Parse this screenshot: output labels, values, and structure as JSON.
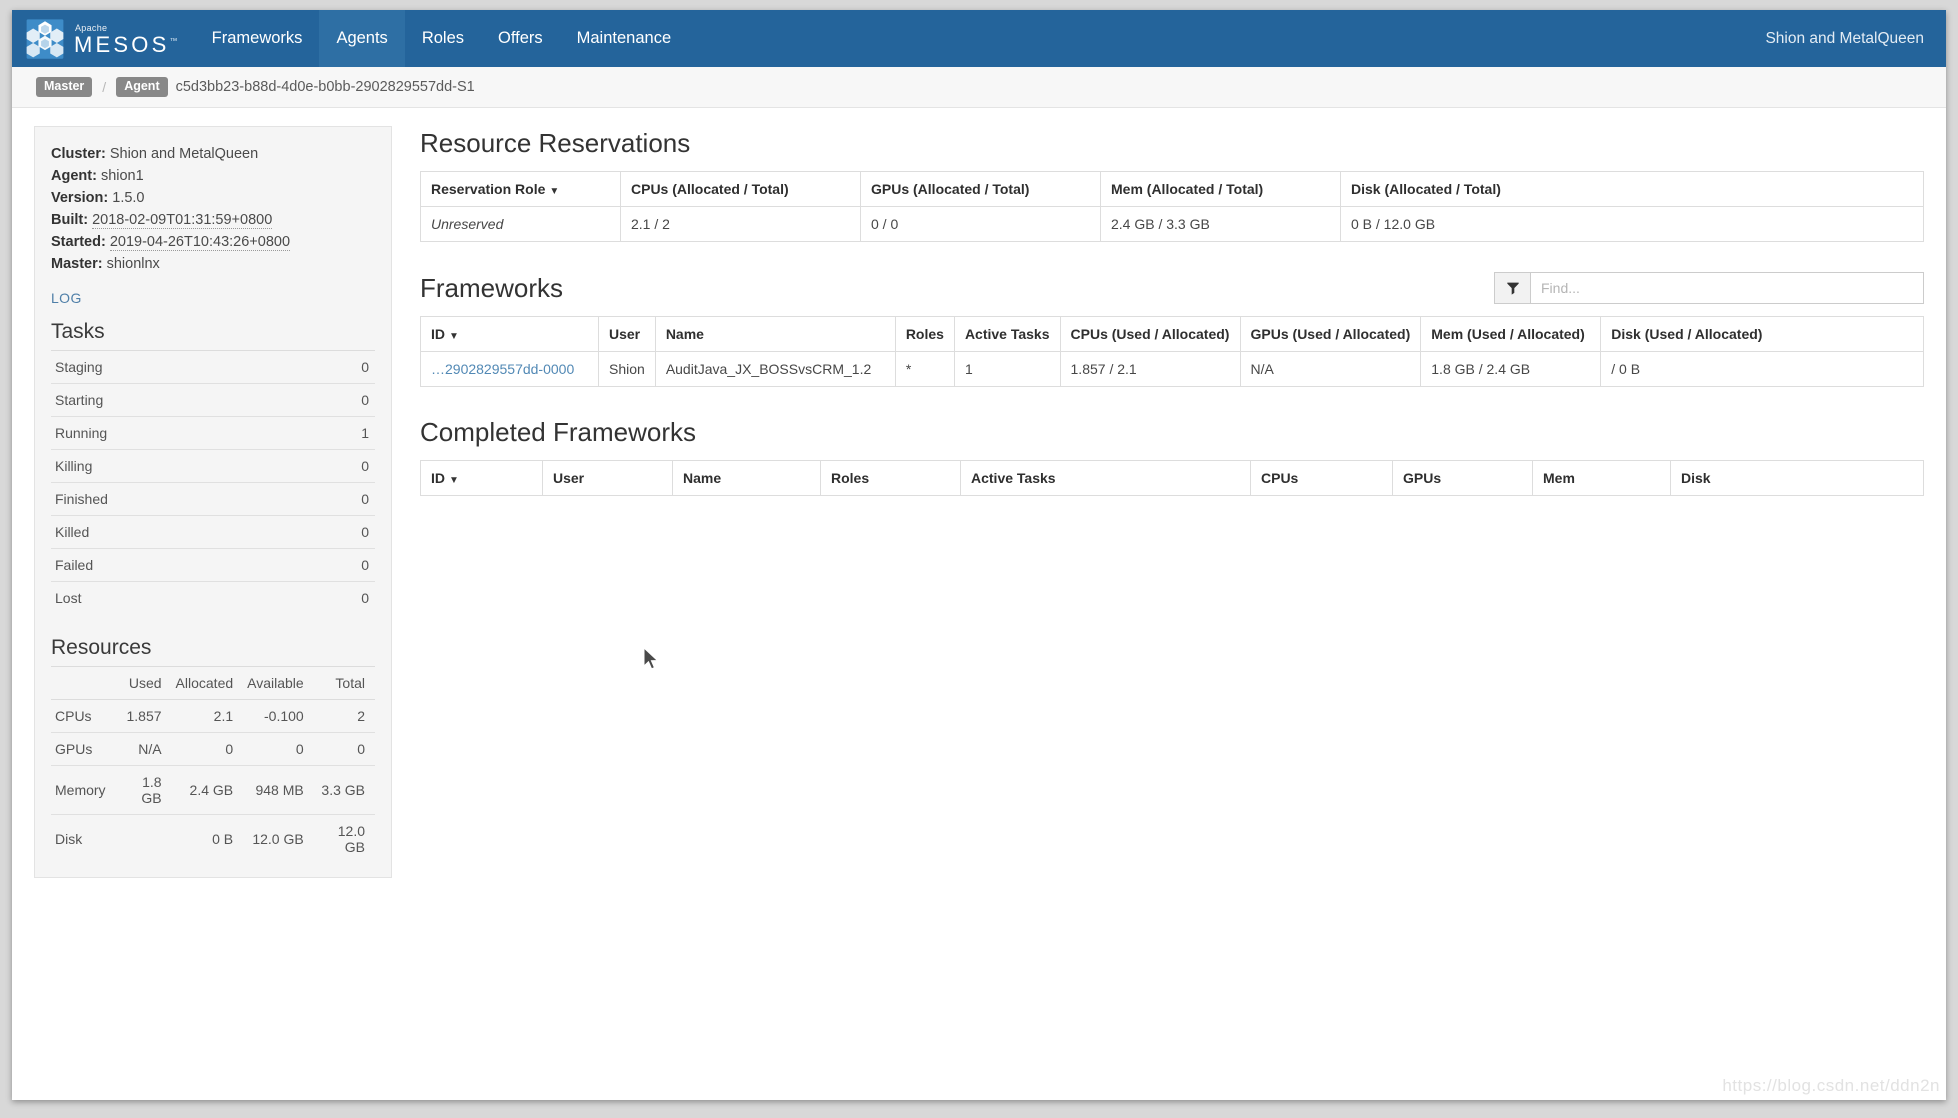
{
  "navbar": {
    "brand_apache": "Apache",
    "brand_name": "MESOS",
    "trademark": "™",
    "items": [
      {
        "label": "Frameworks",
        "active": false
      },
      {
        "label": "Agents",
        "active": true
      },
      {
        "label": "Roles",
        "active": false
      },
      {
        "label": "Offers",
        "active": false
      },
      {
        "label": "Maintenance",
        "active": false
      }
    ],
    "user": "Shion and MetalQueen"
  },
  "breadcrumb": {
    "master_label": "Master",
    "separator": "/",
    "agent_label": "Agent",
    "agent_id": "c5d3bb23-b88d-4d0e-b0bb-2902829557dd-S1"
  },
  "sidebar": {
    "info": [
      {
        "label": "Cluster:",
        "value": "Shion and MetalQueen",
        "dotted": false
      },
      {
        "label": "Agent:",
        "value": "shion1",
        "dotted": false
      },
      {
        "label": "Version:",
        "value": "1.5.0",
        "dotted": false
      },
      {
        "label": "Built:",
        "value": "2018-02-09T01:31:59+0800",
        "dotted": true
      },
      {
        "label": "Started:",
        "value": "2019-04-26T10:43:26+0800",
        "dotted": true
      },
      {
        "label": "Master:",
        "value": "shionlnx",
        "dotted": false
      }
    ],
    "log_link": "LOG",
    "tasks_heading": "Tasks",
    "tasks": [
      {
        "label": "Staging",
        "count": "0"
      },
      {
        "label": "Starting",
        "count": "0"
      },
      {
        "label": "Running",
        "count": "1"
      },
      {
        "label": "Killing",
        "count": "0"
      },
      {
        "label": "Finished",
        "count": "0"
      },
      {
        "label": "Killed",
        "count": "0"
      },
      {
        "label": "Failed",
        "count": "0"
      },
      {
        "label": "Lost",
        "count": "0"
      }
    ],
    "resources_heading": "Resources",
    "resources_columns": [
      "",
      "Used",
      "Allocated",
      "Available",
      "Total"
    ],
    "resources_rows": [
      {
        "name": "CPUs",
        "used": "1.857",
        "allocated": "2.1",
        "available": "-0.100",
        "total": "2"
      },
      {
        "name": "GPUs",
        "used": "N/A",
        "allocated": "0",
        "available": "0",
        "total": "0"
      },
      {
        "name": "Memory",
        "used": "1.8 GB",
        "allocated": "2.4 GB",
        "available": "948 MB",
        "total": "3.3 GB"
      },
      {
        "name": "Disk",
        "used": "",
        "allocated": "0 B",
        "available": "12.0 GB",
        "total": "12.0 GB"
      }
    ]
  },
  "reservations": {
    "heading": "Resource Reservations",
    "columns": [
      "Reservation Role",
      "CPUs (Allocated / Total)",
      "GPUs (Allocated / Total)",
      "Mem (Allocated / Total)",
      "Disk (Allocated / Total)"
    ],
    "sort_caret": "▼",
    "rows": [
      {
        "role": "Unreserved",
        "cpus": "2.1 / 2",
        "gpus": "0 / 0",
        "mem": "2.4 GB / 3.3 GB",
        "disk": "0 B / 12.0 GB"
      }
    ]
  },
  "frameworks": {
    "heading": "Frameworks",
    "search_placeholder": "Find...",
    "search_value": "",
    "filter_icon": "funnel-icon",
    "sort_caret": "▼",
    "columns": [
      "ID",
      "User",
      "Name",
      "Roles",
      "Active Tasks",
      "CPUs (Used / Allocated)",
      "GPUs (Used / Allocated)",
      "Mem (Used / Allocated)",
      "Disk (Used / Allocated)"
    ],
    "rows": [
      {
        "id": "…2902829557dd-0000",
        "user": "Shion",
        "name": "AuditJava_JX_BOSSvsCRM_1.2",
        "roles": "*",
        "active_tasks": "1",
        "cpus": "1.857 / 2.1",
        "gpus": "N/A",
        "mem": "1.8 GB / 2.4 GB",
        "disk": "/ 0 B"
      }
    ]
  },
  "completed_frameworks": {
    "heading": "Completed Frameworks",
    "sort_caret": "▼",
    "columns": [
      "ID",
      "User",
      "Name",
      "Roles",
      "Active Tasks",
      "CPUs",
      "GPUs",
      "Mem",
      "Disk"
    ],
    "rows": []
  },
  "watermark": "https://blog.csdn.net/ddn2n",
  "colors": {
    "navbar": "#24649b",
    "navbar_active": "#2e6fa4",
    "link": "#5289b5",
    "sidebar_bg": "#f5f5f5"
  }
}
